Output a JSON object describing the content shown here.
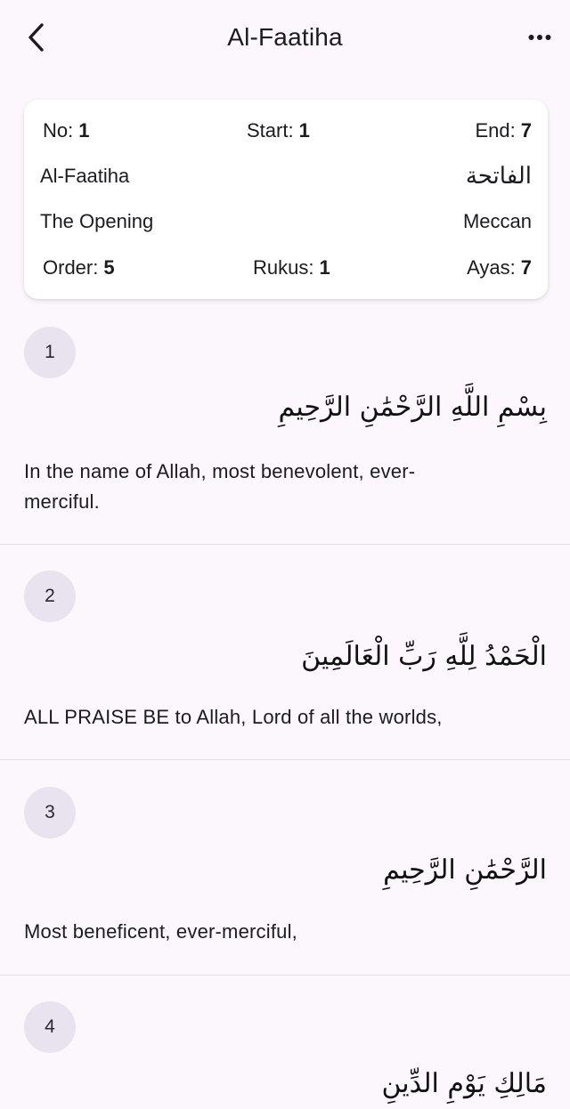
{
  "app_bar": {
    "title": "Al-Faatiha",
    "back_icon": "chevron-left-icon",
    "more_icon": "more-horizontal-icon"
  },
  "surah_info": {
    "no_label": "No:",
    "no_value": "1",
    "start_label": "Start:",
    "start_value": "1",
    "end_label": "End:",
    "end_value": "7",
    "name_latin": "Al-Faatiha",
    "name_arabic": "الفاتحة",
    "name_english": "The Opening",
    "type": "Meccan",
    "order_label": "Order:",
    "order_value": "5",
    "rukus_label": "Rukus:",
    "rukus_value": "1",
    "ayas_label": "Ayas:",
    "ayas_value": "7"
  },
  "ayahs": [
    {
      "number": "1",
      "arabic": "بِسْمِ اللَّهِ الرَّحْمَٰنِ الرَّحِيمِ",
      "translation": "In the name of Allah, most benevolent, ever-merciful."
    },
    {
      "number": "2",
      "arabic": "الْحَمْدُ لِلَّهِ رَبِّ الْعَالَمِينَ",
      "translation": "ALL PRAISE BE to Allah, Lord of all the worlds,"
    },
    {
      "number": "3",
      "arabic": "الرَّحْمَٰنِ الرَّحِيمِ",
      "translation": "Most beneficent, ever-merciful,"
    },
    {
      "number": "4",
      "arabic": "مَالِكِ يَوْمِ الدِّينِ",
      "translation": ""
    }
  ],
  "colors": {
    "background": "#fcf7fc",
    "card": "#ffffff",
    "number_badge": "#e8e3ee",
    "divider": "#e3dfe4",
    "text": "#1c1b1f"
  }
}
